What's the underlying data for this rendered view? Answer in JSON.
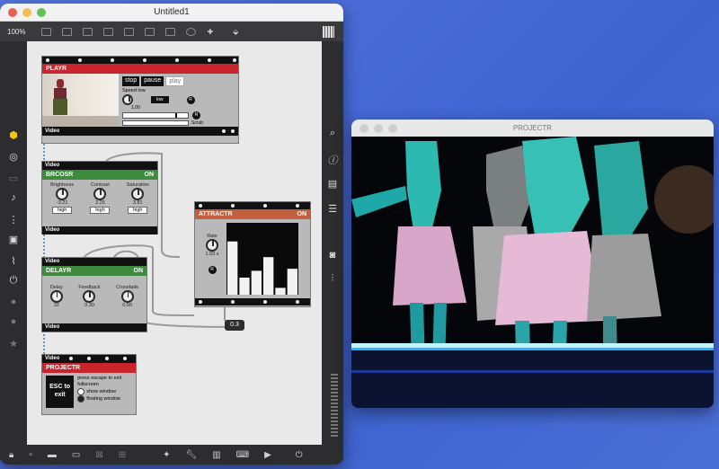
{
  "main_window": {
    "title": "Untitled1",
    "zoom": "100%",
    "cables_value": "0.3"
  },
  "playr": {
    "name": "PLAYR",
    "stop": "stop",
    "pause": "pause",
    "play": "play",
    "speed_label": "Speed low",
    "speed_value": "1.00",
    "low": "low",
    "scrub": "Scrub",
    "reset": "R",
    "out": "Video"
  },
  "brcosr": {
    "name": "BRCOSR",
    "status": "ON",
    "in": "Video",
    "out": "Video",
    "knobs": [
      {
        "label": "Brightness",
        "value": "-3.21",
        "range": "high"
      },
      {
        "label": "Contrast",
        "value": "2.26",
        "range": "high"
      },
      {
        "label": "Saturation",
        "value": "3.81",
        "range": "high"
      }
    ]
  },
  "attractr": {
    "name": "ATTRACTR",
    "status": "ON",
    "rate_label": "Rate",
    "rate_value": "1.03 s",
    "reset": "R",
    "bars": [
      0.78,
      0.25,
      0.35,
      0.55,
      0.1,
      0.38
    ]
  },
  "delayr": {
    "name": "DELAYR",
    "status": "ON",
    "in": "Video",
    "out": "Video",
    "knobs": [
      {
        "label": "Delay",
        "value": "32"
      },
      {
        "label": "Feedback",
        "value": "0.30"
      },
      {
        "label": "Crossfade",
        "value": "0.50"
      }
    ]
  },
  "projectr": {
    "name": "PROJECTR",
    "in": "Video",
    "esc": "ESC to exit",
    "hint": "press escape to exit fullscreen",
    "show_window": "show window",
    "floating_window": "floating window"
  },
  "projector_window": {
    "title": "PROJECTR"
  }
}
